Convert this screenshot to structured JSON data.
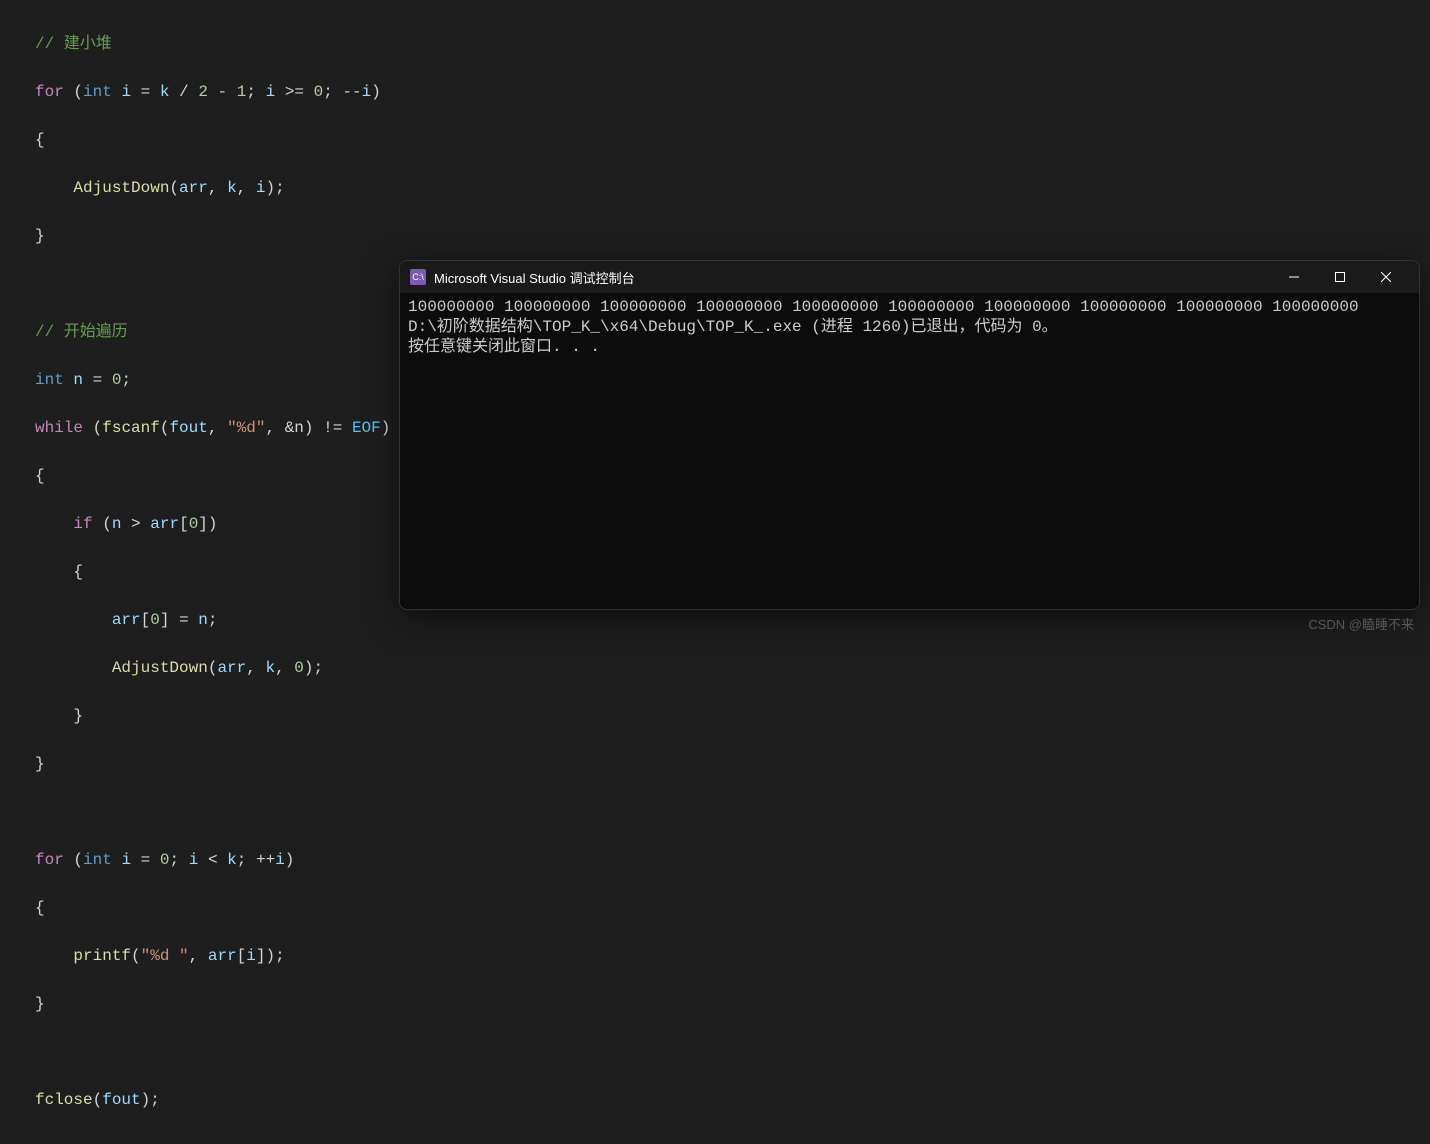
{
  "code": {
    "comment_build_heap": "// 建小堆",
    "kw_for": "for",
    "kw_int": "int",
    "kw_while": "while",
    "kw_if": "if",
    "var_i": "i",
    "var_k": "k",
    "var_n": "n",
    "var_arr": "arr",
    "var_fout": "fout",
    "num_0": "0",
    "num_1": "1",
    "num_2": "2",
    "func_AdjustDown": "AdjustDown",
    "func_fscanf": "fscanf",
    "func_printf": "printf",
    "func_fclose": "fclose",
    "str_pct_d_in": "\"%d\"",
    "str_pct_d_out": "\"%d \"",
    "const_EOF": "EOF",
    "op_amp_n": "&n",
    "comment_iterate": "// 开始遍历"
  },
  "console": {
    "title": "Microsoft Visual Studio 调试控制台",
    "icon_text": "C:\\",
    "output_line1": "100000000 100000000 100000000 100000000 100000000 100000000 100000000 100000000 100000000 100000000",
    "output_line2": "",
    "output_line3": "D:\\初阶数据结构\\TOP_K_\\x64\\Debug\\TOP_K_.exe (进程 1260)已退出，代码为 0。",
    "output_line4": "按任意键关闭此窗口. . ."
  },
  "watermark": "CSDN @瞌睡不来"
}
